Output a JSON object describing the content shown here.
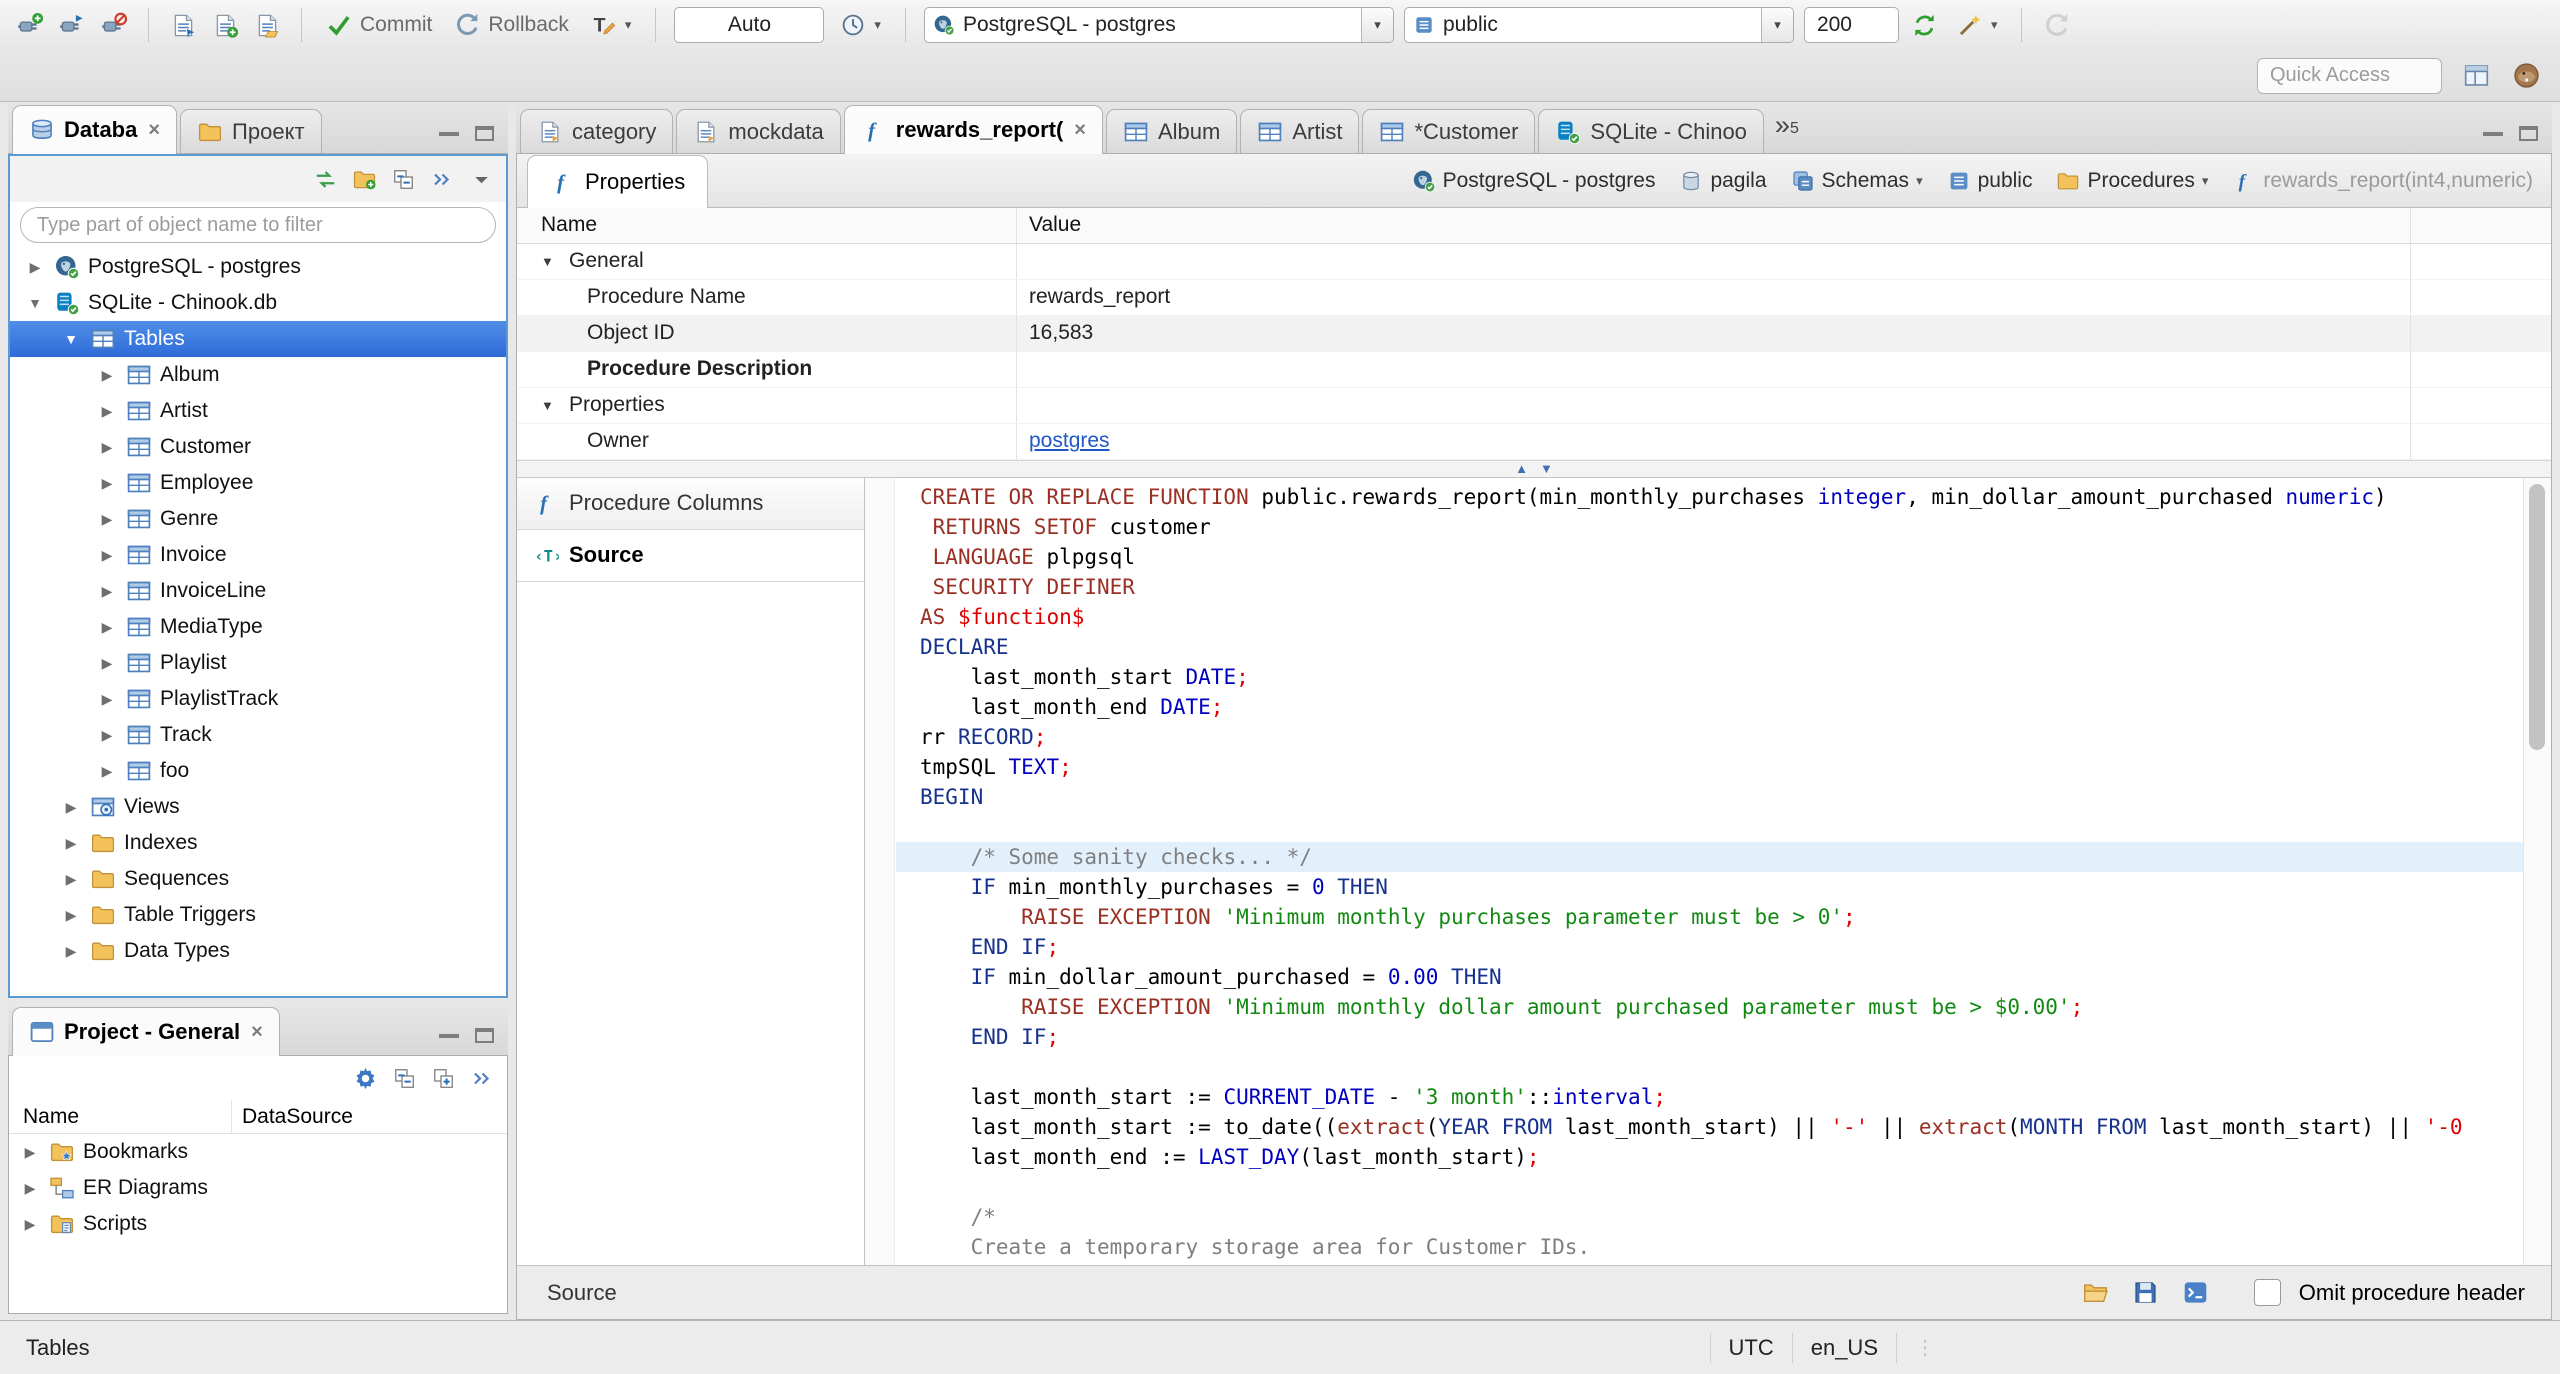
{
  "toolbar": {
    "commit": "Commit",
    "rollback": "Rollback",
    "auto_commit": "Auto",
    "datasource": "PostgreSQL - postgres",
    "schema": "public",
    "fetch_size": "200",
    "quick_access_placeholder": "Quick Access"
  },
  "left_tabs": [
    {
      "label": "Databa",
      "icon": "dbnav",
      "close": true,
      "active": true
    },
    {
      "label": "Проект",
      "icon": "folder"
    }
  ],
  "navigator": {
    "filter_placeholder": "Type part of object name to filter",
    "tree": [
      {
        "label": "PostgreSQL - postgres",
        "icon": "pgdb",
        "depth": 0,
        "arrow": "collapsed"
      },
      {
        "label": "SQLite - Chinook.db",
        "icon": "sqlitedb",
        "depth": 0,
        "arrow": "expanded"
      },
      {
        "label": "Tables",
        "icon": "table",
        "depth": 1,
        "arrow": "expanded",
        "selected": true
      },
      {
        "label": "Album",
        "icon": "table",
        "depth": 2,
        "arrow": "collapsed"
      },
      {
        "label": "Artist",
        "icon": "table",
        "depth": 2,
        "arrow": "collapsed"
      },
      {
        "label": "Customer",
        "icon": "table",
        "depth": 2,
        "arrow": "collapsed"
      },
      {
        "label": "Employee",
        "icon": "table",
        "depth": 2,
        "arrow": "collapsed"
      },
      {
        "label": "Genre",
        "icon": "table",
        "depth": 2,
        "arrow": "collapsed"
      },
      {
        "label": "Invoice",
        "icon": "table",
        "depth": 2,
        "arrow": "collapsed"
      },
      {
        "label": "InvoiceLine",
        "icon": "table",
        "depth": 2,
        "arrow": "collapsed"
      },
      {
        "label": "MediaType",
        "icon": "table",
        "depth": 2,
        "arrow": "collapsed"
      },
      {
        "label": "Playlist",
        "icon": "table",
        "depth": 2,
        "arrow": "collapsed"
      },
      {
        "label": "PlaylistTrack",
        "icon": "table",
        "depth": 2,
        "arrow": "collapsed"
      },
      {
        "label": "Track",
        "icon": "table",
        "depth": 2,
        "arrow": "collapsed"
      },
      {
        "label": "foo",
        "icon": "table",
        "depth": 2,
        "arrow": "collapsed"
      },
      {
        "label": "Views",
        "icon": "views",
        "depth": 1,
        "arrow": "collapsed"
      },
      {
        "label": "Indexes",
        "icon": "folder",
        "depth": 1,
        "arrow": "collapsed"
      },
      {
        "label": "Sequences",
        "icon": "folder",
        "depth": 1,
        "arrow": "collapsed"
      },
      {
        "label": "Table Triggers",
        "icon": "folder",
        "depth": 1,
        "arrow": "collapsed"
      },
      {
        "label": "Data Types",
        "icon": "folder",
        "depth": 1,
        "arrow": "collapsed"
      }
    ]
  },
  "project_panel": {
    "title": "Project - General",
    "columns": [
      "Name",
      "DataSource"
    ],
    "items": [
      {
        "label": "Bookmarks",
        "icon": "bookmarks"
      },
      {
        "label": "ER Diagrams",
        "icon": "erd"
      },
      {
        "label": "Scripts",
        "icon": "scripts"
      }
    ]
  },
  "editor_tabs": [
    {
      "label": "category",
      "icon": "sqlscript"
    },
    {
      "label": "mockdata",
      "icon": "sqlscript"
    },
    {
      "label": "rewards_report(",
      "icon": "fn",
      "active": true,
      "close": true
    },
    {
      "label": "Album",
      "icon": "table"
    },
    {
      "label": "Artist",
      "icon": "table"
    },
    {
      "label": "*Customer",
      "icon": "table"
    },
    {
      "label": "SQLite - Chinoo",
      "icon": "sqlitedb"
    }
  ],
  "tab_overflow": "5",
  "properties_view": {
    "tab": "Properties",
    "breadcrumb": [
      {
        "label": "PostgreSQL - postgres",
        "icon": "pgdb"
      },
      {
        "label": "pagila",
        "icon": "db"
      },
      {
        "label": "Schemas",
        "icon": "schemas",
        "dropdown": true
      },
      {
        "label": "public",
        "icon": "schema"
      },
      {
        "label": "Procedures",
        "icon": "folder",
        "dropdown": true
      },
      {
        "label": "rewards_report(int4,numeric)",
        "icon": "fn",
        "dim": true
      }
    ],
    "grid": {
      "name_header": "Name",
      "value_header": "Value",
      "rows": [
        {
          "name": "General",
          "group": true
        },
        {
          "name": "Procedure Name",
          "value": "rewards_report"
        },
        {
          "name": "Object ID",
          "value": "16,583",
          "shaded": true
        },
        {
          "name": "Procedure Description",
          "bold": true
        },
        {
          "name": "Properties",
          "group": true
        },
        {
          "name": "Owner",
          "value": "postgres",
          "link": true
        }
      ]
    },
    "sections": [
      {
        "label": "Procedure Columns",
        "icon": "fn"
      },
      {
        "label": "Source",
        "icon": "source",
        "active": true
      }
    ]
  },
  "source": {
    "highlight_line": 13,
    "lines": [
      [
        {
          "c": "kw",
          "t": "CREATE OR REPLACE FUNCTION "
        },
        {
          "c": "pl",
          "t": "public.rewards_report(min_monthly_purchases "
        },
        {
          "c": "ty",
          "t": "integer"
        },
        {
          "c": "pl",
          "t": ", min_dollar_amount_purchased "
        },
        {
          "c": "ty",
          "t": "numeric"
        },
        {
          "c": "pl",
          "t": ")"
        }
      ],
      [
        {
          "c": "pl",
          "t": " "
        },
        {
          "c": "kw",
          "t": "RETURNS SETOF"
        },
        {
          "c": "pl",
          "t": " customer"
        }
      ],
      [
        {
          "c": "pl",
          "t": " "
        },
        {
          "c": "kw",
          "t": "LANGUAGE"
        },
        {
          "c": "pl",
          "t": " plpgsql"
        }
      ],
      [
        {
          "c": "pl",
          "t": " "
        },
        {
          "c": "kw",
          "t": "SECURITY DEFINER"
        }
      ],
      [
        {
          "c": "kw",
          "t": "AS"
        },
        {
          "c": "dl",
          "t": " $function$"
        }
      ],
      [
        {
          "c": "k2",
          "t": "DECLARE"
        }
      ],
      [
        {
          "c": "pl",
          "t": "    last_month_start "
        },
        {
          "c": "ty",
          "t": "DATE"
        },
        {
          "c": "dl",
          "t": ";"
        }
      ],
      [
        {
          "c": "pl",
          "t": "    last_month_end "
        },
        {
          "c": "ty",
          "t": "DATE"
        },
        {
          "c": "dl",
          "t": ";"
        }
      ],
      [
        {
          "c": "pl",
          "t": "rr "
        },
        {
          "c": "k2",
          "t": "RECORD"
        },
        {
          "c": "dl",
          "t": ";"
        }
      ],
      [
        {
          "c": "pl",
          "t": "tmpSQL "
        },
        {
          "c": "ty",
          "t": "TEXT"
        },
        {
          "c": "dl",
          "t": ";"
        }
      ],
      [
        {
          "c": "k2",
          "t": "BEGIN"
        }
      ],
      [],
      [
        {
          "c": "pl",
          "t": "    "
        },
        {
          "c": "cm",
          "t": "/* Some sanity checks... */"
        }
      ],
      [
        {
          "c": "pl",
          "t": "    "
        },
        {
          "c": "k2",
          "t": "IF"
        },
        {
          "c": "pl",
          "t": " min_monthly_purchases = "
        },
        {
          "c": "ty",
          "t": "0"
        },
        {
          "c": "pl",
          "t": " "
        },
        {
          "c": "k2",
          "t": "THEN"
        }
      ],
      [
        {
          "c": "pl",
          "t": "        "
        },
        {
          "c": "kw",
          "t": "RAISE EXCEPTION"
        },
        {
          "c": "pl",
          "t": " "
        },
        {
          "c": "st",
          "t": "'Minimum monthly purchases parameter must be > 0'"
        },
        {
          "c": "dl",
          "t": ";"
        }
      ],
      [
        {
          "c": "pl",
          "t": "    "
        },
        {
          "c": "k2",
          "t": "END IF"
        },
        {
          "c": "dl",
          "t": ";"
        }
      ],
      [
        {
          "c": "pl",
          "t": "    "
        },
        {
          "c": "k2",
          "t": "IF"
        },
        {
          "c": "pl",
          "t": " min_dollar_amount_purchased = "
        },
        {
          "c": "ty",
          "t": "0.00"
        },
        {
          "c": "pl",
          "t": " "
        },
        {
          "c": "k2",
          "t": "THEN"
        }
      ],
      [
        {
          "c": "pl",
          "t": "        "
        },
        {
          "c": "kw",
          "t": "RAISE EXCEPTION"
        },
        {
          "c": "pl",
          "t": " "
        },
        {
          "c": "st",
          "t": "'Minimum monthly dollar amount purchased parameter must be > $0.00'"
        },
        {
          "c": "dl",
          "t": ";"
        }
      ],
      [
        {
          "c": "pl",
          "t": "    "
        },
        {
          "c": "k2",
          "t": "END IF"
        },
        {
          "c": "dl",
          "t": ";"
        }
      ],
      [],
      [
        {
          "c": "pl",
          "t": "    last_month_start := "
        },
        {
          "c": "ty",
          "t": "CURRENT_DATE"
        },
        {
          "c": "pl",
          "t": " - "
        },
        {
          "c": "st",
          "t": "'3 month'"
        },
        {
          "c": "pl",
          "t": "::"
        },
        {
          "c": "ty",
          "t": "interval"
        },
        {
          "c": "dl",
          "t": ";"
        }
      ],
      [
        {
          "c": "pl",
          "t": "    last_month_start := to_date(("
        },
        {
          "c": "kw",
          "t": "extract"
        },
        {
          "c": "pl",
          "t": "("
        },
        {
          "c": "k2",
          "t": "YEAR FROM"
        },
        {
          "c": "pl",
          "t": " last_month_start) || "
        },
        {
          "c": "dl",
          "t": "'-'"
        },
        {
          "c": "pl",
          "t": " || "
        },
        {
          "c": "kw",
          "t": "extract"
        },
        {
          "c": "pl",
          "t": "("
        },
        {
          "c": "k2",
          "t": "MONTH FROM"
        },
        {
          "c": "pl",
          "t": " last_month_start) || "
        },
        {
          "c": "dl",
          "t": "'-0"
        }
      ],
      [
        {
          "c": "pl",
          "t": "    last_month_end := "
        },
        {
          "c": "ty",
          "t": "LAST_DAY"
        },
        {
          "c": "pl",
          "t": "(last_month_start)"
        },
        {
          "c": "dl",
          "t": ";"
        }
      ],
      [],
      [
        {
          "c": "pl",
          "t": "    "
        },
        {
          "c": "cm",
          "t": "/*"
        }
      ],
      [
        {
          "c": "pl",
          "t": "    "
        },
        {
          "c": "cm",
          "t": "Create a temporary storage area for Customer IDs."
        }
      ],
      [
        {
          "c": "pl",
          "t": "    "
        },
        {
          "c": "cm",
          "t": "*/"
        }
      ]
    ]
  },
  "editor_footer": {
    "label": "Source",
    "omit_label": "Omit procedure header"
  },
  "status_bar": {
    "left": "Tables",
    "timezone": "UTC",
    "locale": "en_US"
  }
}
